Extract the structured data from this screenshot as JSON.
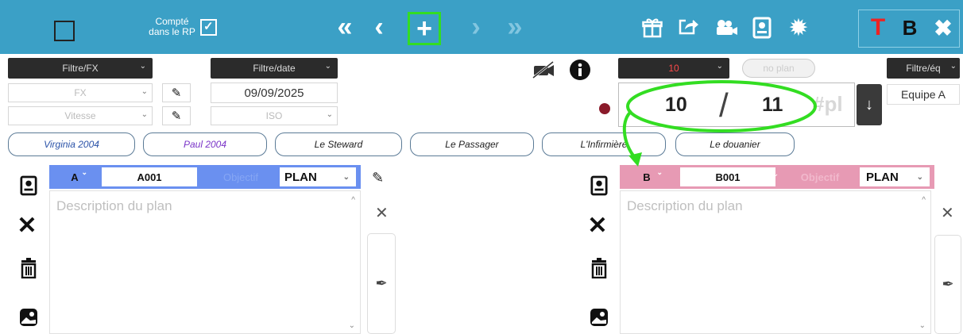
{
  "toolbar": {
    "counted_label_line1": "Compté",
    "counted_label_line2": "dans le RP",
    "counted_checked": "✓",
    "icons": [
      "square-outline-icon",
      "double-chevron-left-icon",
      "chevron-left-icon",
      "plus-icon",
      "chevron-right-icon",
      "double-chevron-right-icon",
      "gift-icon",
      "share-icon",
      "camera-icon",
      "portrait-icon",
      "gear-icon",
      "t-icon",
      "b-icon",
      "close-icon"
    ],
    "accent_color": "#3ba0c6",
    "highlight_color": "#33dd22",
    "t_label": "T",
    "b_label": "B"
  },
  "filters": {
    "fx_filter": "Filtre/FX",
    "date_filter": "Filtre/date",
    "fx_select": "FX",
    "speed_select": "Vitesse",
    "date_value": "09/09/2025",
    "iso_select": "ISO",
    "num_select": "10",
    "no_plan": "no plan",
    "team_filter": "Filtre/éq",
    "team_value": "Equipe A"
  },
  "counter": {
    "current": "10",
    "next": "11",
    "suffix": "#pl"
  },
  "personas": [
    "Virginia 2004",
    "Paul 2004",
    "Le Steward",
    "Le Passager",
    "L'Infirmière",
    "Le douanier"
  ],
  "plan_a": {
    "letter": "A",
    "code": "A001",
    "objective": "Objectif",
    "plan": "PLAN",
    "placeholder": "Description du plan",
    "header_color": "#6a90f0"
  },
  "plan_b": {
    "letter": "B",
    "code": "B001",
    "objective": "Objectif",
    "plan": "PLAN",
    "placeholder": "Description du plan",
    "header_color": "#e79ab4"
  }
}
